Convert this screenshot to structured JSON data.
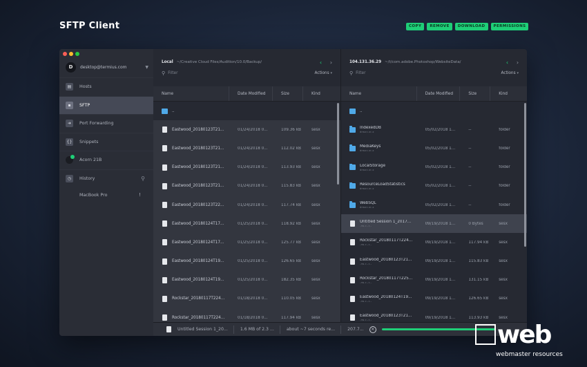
{
  "app": {
    "title": "SFTP Client"
  },
  "top_actions": [
    "COPY",
    "REMOVE",
    "DOWNLOAD",
    "PERMISSIONS"
  ],
  "colors": {
    "accent": "#1fcf78",
    "folder": "#4fa9e8"
  },
  "sidebar": {
    "account": {
      "initial": "D",
      "name": "desktop@termius.com"
    },
    "items": [
      {
        "label": "Hosts",
        "icon": "hosts-icon"
      },
      {
        "label": "SFTP",
        "icon": "sftp-icon",
        "active": true
      },
      {
        "label": "Port Forwarding",
        "icon": "port-forwarding-icon"
      },
      {
        "label": "Snippets",
        "icon": "snippets-icon"
      },
      {
        "label": "Acorn 21B",
        "icon": "host-status-icon"
      },
      {
        "label": "History",
        "icon": "history-icon"
      }
    ],
    "history_items": [
      {
        "label": "MacBook Pro",
        "marker": "!"
      }
    ]
  },
  "left_pane": {
    "host": "Local",
    "path": "~/Creative Cloud Files/Audition/10.0/Backup/",
    "filter_placeholder": "Filter",
    "actions_label": "Actions",
    "columns": [
      "Name",
      "Date Modified",
      "Size",
      "Kind"
    ],
    "rows": [
      {
        "type": "folder",
        "name": "..",
        "date": "",
        "size": "",
        "kind": ""
      },
      {
        "type": "file",
        "name": "Eastwood_20180123T21...",
        "date": "01/24/2018 0...",
        "size": "109.36 kB",
        "kind": "sesx"
      },
      {
        "type": "file",
        "name": "Eastwood_20180123T21...",
        "date": "01/24/2018 0...",
        "size": "112.02 kB",
        "kind": "sesx"
      },
      {
        "type": "file",
        "name": "Eastwood_20180123T21...",
        "date": "01/24/2018 0...",
        "size": "113.93 kB",
        "kind": "sesx"
      },
      {
        "type": "file",
        "name": "Eastwood_20180123T21...",
        "date": "01/24/2018 0...",
        "size": "115.83 kB",
        "kind": "sesx"
      },
      {
        "type": "file",
        "name": "Eastwood_20180123T22...",
        "date": "01/24/2018 0...",
        "size": "117.74 kB",
        "kind": "sesx"
      },
      {
        "type": "file",
        "name": "Eastwood_20180124T17...",
        "date": "01/25/2018 0...",
        "size": "118.92 kB",
        "kind": "sesx"
      },
      {
        "type": "file",
        "name": "Eastwood_20180124T17...",
        "date": "01/25/2018 0...",
        "size": "125.77 kB",
        "kind": "sesx"
      },
      {
        "type": "file",
        "name": "Eastwood_20180124T19...",
        "date": "01/25/2018 0...",
        "size": "126.65 kB",
        "kind": "sesx"
      },
      {
        "type": "file",
        "name": "Eastwood_20180124T19...",
        "date": "01/25/2018 0...",
        "size": "182.35 kB",
        "kind": "sesx"
      },
      {
        "type": "file",
        "name": "Rockstar_20180117T224...",
        "date": "01/18/2018 0...",
        "size": "110.05 kB",
        "kind": "sesx"
      },
      {
        "type": "file",
        "name": "Rockstar_20180117T224...",
        "date": "01/18/2018 0...",
        "size": "117.94 kB",
        "kind": "sesx"
      }
    ]
  },
  "right_pane": {
    "host": "104.131.36.29",
    "path": "~/t/com.adobe.Photoshop/WebsiteData/",
    "filter_placeholder": "Filter",
    "actions_label": "Actions",
    "columns": [
      "Name",
      "Date Modified",
      "Size",
      "Kind"
    ],
    "rows": [
      {
        "type": "folder",
        "name": "..",
        "sub": "",
        "date": "",
        "size": "",
        "kind": ""
      },
      {
        "type": "folder",
        "name": "IndexedDB",
        "sub": "drwxr-xr-x",
        "date": "05/02/2018 1...",
        "size": "--",
        "kind": "folder"
      },
      {
        "type": "folder",
        "name": "MediaKeys",
        "sub": "drwxr-xr-x",
        "date": "05/02/2018 1...",
        "size": "--",
        "kind": "folder"
      },
      {
        "type": "folder",
        "name": "LocalStorage",
        "sub": "drwxr-xr-x",
        "date": "05/02/2018 1...",
        "size": "--",
        "kind": "folder"
      },
      {
        "type": "folder",
        "name": "ResourceLoadStatistics",
        "sub": "drwxr-xr-x",
        "date": "05/02/2018 1...",
        "size": "--",
        "kind": "folder"
      },
      {
        "type": "folder",
        "name": "WebSQL",
        "sub": "drwxr-xr-x",
        "date": "05/02/2018 1...",
        "size": "--",
        "kind": "folder"
      },
      {
        "type": "file",
        "name": "Untitled Session 1_2017...",
        "sub": "-rw-r--r--",
        "date": "09/19/2018 1...",
        "size": "0 Bytes",
        "kind": "sesx",
        "highlight": true
      },
      {
        "type": "file",
        "name": "Rockstar_20180117T224...",
        "sub": "-rw-r--r--",
        "date": "09/19/2018 1...",
        "size": "117.94 kB",
        "kind": "sesx"
      },
      {
        "type": "file",
        "name": "Eastwood_20180123T21...",
        "sub": "-rw-r--r--",
        "date": "09/19/2018 1...",
        "size": "115.83 kB",
        "kind": "sesx"
      },
      {
        "type": "file",
        "name": "Rockstar_20180117T225...",
        "sub": "-rw-r--r--",
        "date": "09/19/2018 1...",
        "size": "131.15 kB",
        "kind": "sesx"
      },
      {
        "type": "file",
        "name": "Eastwood_20180124T19...",
        "sub": "-rw-r--r--",
        "date": "09/19/2018 1...",
        "size": "126.65 kB",
        "kind": "sesx"
      },
      {
        "type": "file",
        "name": "Eastwood_20180123T21...",
        "sub": "-rw-r--r--",
        "date": "09/19/2018 1...",
        "size": "113.93 kB",
        "kind": "sesx"
      }
    ]
  },
  "transfer": {
    "file": "Untitled Session 1_20...",
    "progress_text": "1.6 MB of 2.3 ...",
    "eta": "about ~7 seconds re...",
    "speed": "207.7...",
    "progress_fraction": 0.75
  },
  "watermark": {
    "logo": "web",
    "subtitle": "webmaster resources"
  }
}
